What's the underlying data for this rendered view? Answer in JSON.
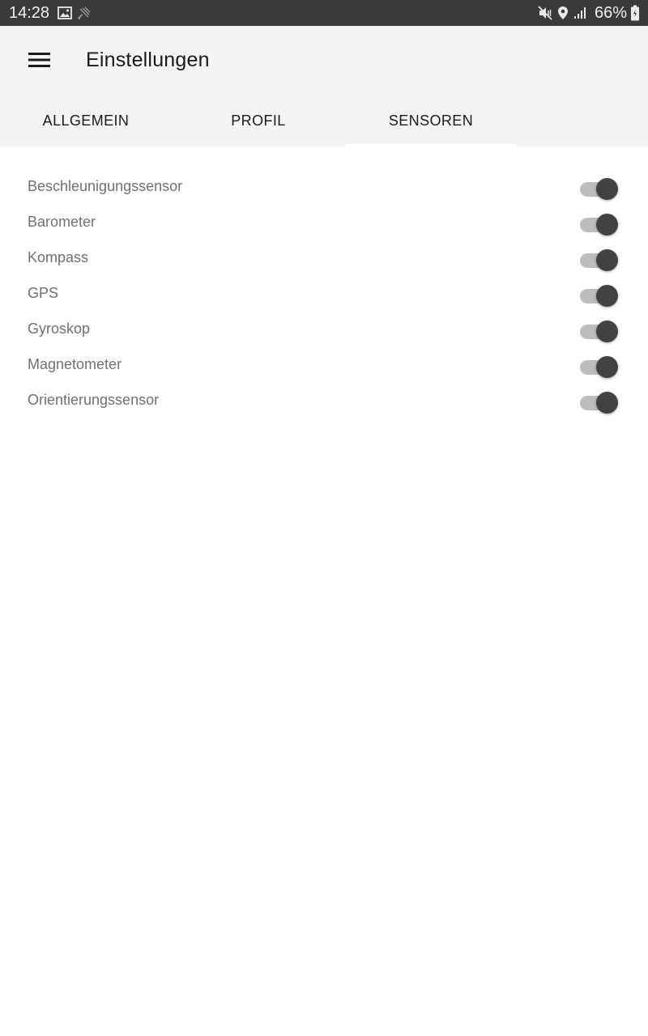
{
  "status_bar": {
    "time": "14:28",
    "battery": "66%",
    "icons": [
      "image-icon",
      "cast-icon",
      "mute-icon",
      "location-icon",
      "signal-icon",
      "battery-icon"
    ]
  },
  "app_bar": {
    "title": "Einstellungen",
    "menu_icon": "hamburger-menu-icon"
  },
  "tabs": [
    {
      "label": "ALLGEMEIN",
      "selected": false
    },
    {
      "label": "PROFIL",
      "selected": false
    },
    {
      "label": "SENSOREN",
      "selected": true
    }
  ],
  "sensors": [
    {
      "label": "Beschleunigungssensor",
      "enabled": true
    },
    {
      "label": "Barometer",
      "enabled": true
    },
    {
      "label": "Kompass",
      "enabled": true
    },
    {
      "label": "GPS",
      "enabled": true
    },
    {
      "label": "Gyroskop",
      "enabled": true
    },
    {
      "label": "Magnetometer",
      "enabled": true
    },
    {
      "label": "Orientierungssensor",
      "enabled": true
    }
  ],
  "colors": {
    "status_bar": "#3a3a3a",
    "app_bar": "#f4f4f4",
    "switch_track": "#bdbdbd",
    "switch_thumb": "#424242",
    "label_text": "#707070"
  }
}
